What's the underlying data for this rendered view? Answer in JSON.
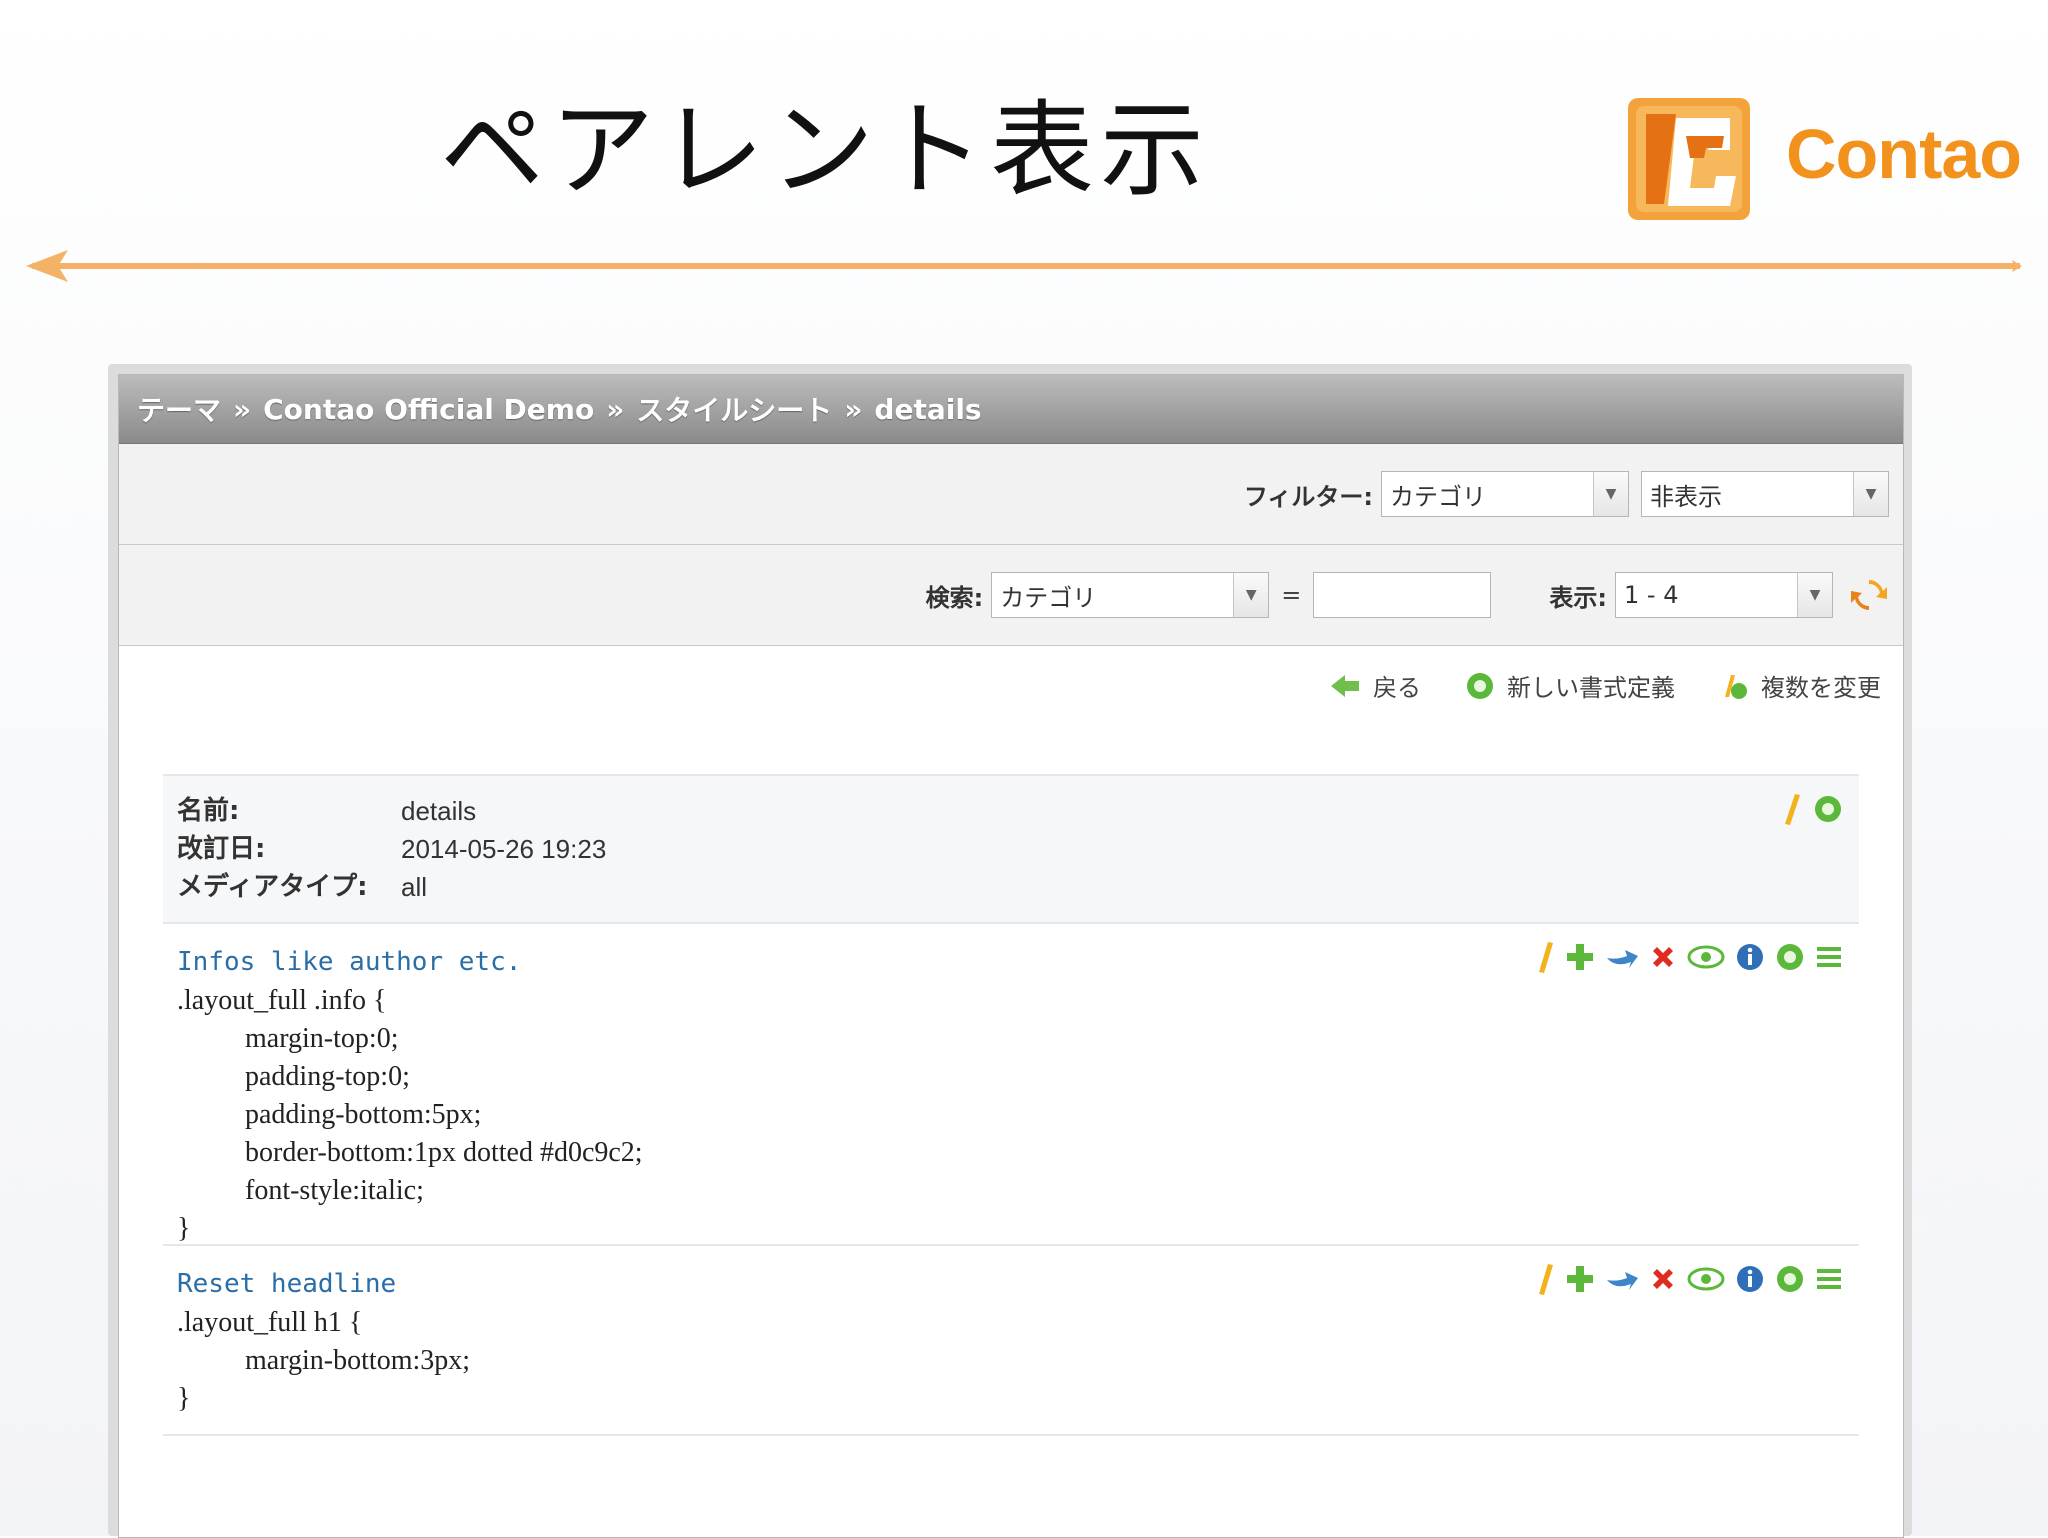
{
  "slide": {
    "title": "ペアレント表示",
    "logo_text": "Contao",
    "accent": "#f4b266"
  },
  "breadcrumb": {
    "items": [
      "テーマ",
      "Contao Official Demo",
      "スタイルシート",
      "details"
    ],
    "separator": "»"
  },
  "filter": {
    "label": "フィルター:",
    "select1": "カテゴリ",
    "select2": "非表示"
  },
  "search": {
    "label": "検索:",
    "field": "カテゴリ",
    "equals": "=",
    "value": "",
    "show_label": "表示:",
    "show_value": "1 - 4"
  },
  "actions": {
    "back": "戻る",
    "new": "新しい書式定義",
    "multi": "複数を変更"
  },
  "header_info": {
    "name_label": "名前:",
    "name_value": "details",
    "modified_label": "改訂日:",
    "modified_value": "2014-05-26 19:23",
    "media_label": "メディアタイプ:",
    "media_value": "all"
  },
  "styles": [
    {
      "comment": "Infos like author etc.",
      "selector": ".layout_full .info {",
      "props": [
        "margin-top:0;",
        "padding-top:0;",
        "padding-bottom:5px;",
        "border-bottom:1px dotted #d0c9c2;",
        "font-style:italic;"
      ],
      "close": "}"
    },
    {
      "comment": "Reset headline",
      "selector": ".layout_full h1 {",
      "props": [
        "margin-bottom:3px;"
      ],
      "close": "}"
    }
  ],
  "icons": {
    "edit": "pencil-icon",
    "copy": "plus-icon",
    "move": "cut-arrow-icon",
    "delete": "delete-x-icon",
    "toggle": "eye-icon",
    "info": "info-icon",
    "paste": "paste-icon",
    "drag": "drag-handle-icon"
  }
}
